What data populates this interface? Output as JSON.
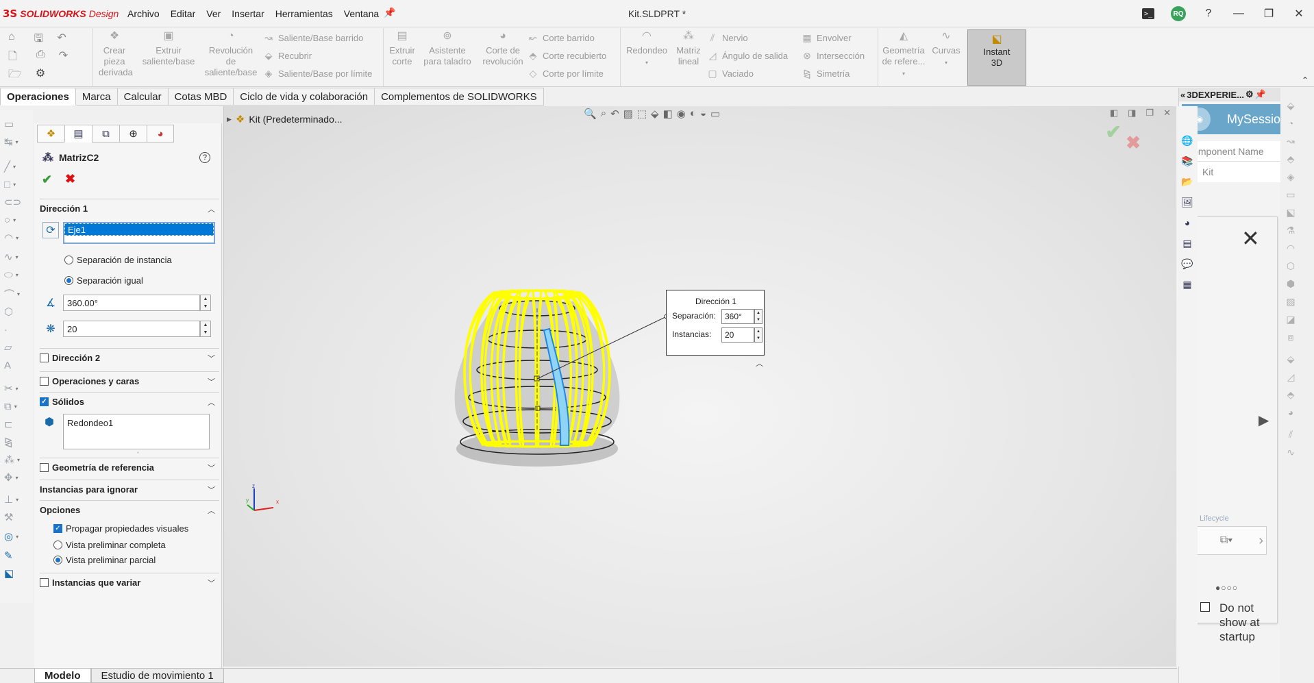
{
  "titlebar": {
    "brand_ds": "3S",
    "brand_name": "SOLIDWORKS",
    "brand_suffix": "Design",
    "menu": [
      "Archivo",
      "Editar",
      "Ver",
      "Insertar",
      "Herramientas",
      "Ventana"
    ],
    "document": "Kit.SLDPRT *",
    "user_initials": "RQ"
  },
  "ribbon": {
    "big_buttons": [
      {
        "label_lines": [
          "Crear",
          "pieza",
          "derivada"
        ],
        "icon": "derived-part-icon"
      },
      {
        "label_lines": [
          "Extruir",
          "saliente/base"
        ],
        "icon": "extrude-boss-icon"
      },
      {
        "label_lines": [
          "Revolución",
          "de",
          "saliente/base"
        ],
        "icon": "revolve-boss-icon"
      },
      {
        "label_lines": [
          "Extruir",
          "corte"
        ],
        "icon": "extrude-cut-icon"
      },
      {
        "label_lines": [
          "Asistente",
          "para taladro"
        ],
        "icon": "hole-wizard-icon"
      },
      {
        "label_lines": [
          "Corte de",
          "revolución"
        ],
        "icon": "revolve-cut-icon"
      },
      {
        "label_lines": [
          "Redondeo"
        ],
        "icon": "fillet-icon"
      },
      {
        "label_lines": [
          "Matriz",
          "lineal"
        ],
        "icon": "linear-pattern-icon"
      },
      {
        "label_lines": [
          "Geometría",
          "de refere..."
        ],
        "icon": "reference-geometry-icon"
      },
      {
        "label_lines": [
          "Curvas"
        ],
        "icon": "curves-icon"
      }
    ],
    "small_col1": [
      "Saliente/Base barrido",
      "Recubrir",
      "Saliente/Base por límite"
    ],
    "small_col2": [
      "Corte barrido",
      "Corte recubierto",
      "Corte por límite"
    ],
    "small_col3": [
      "Nervio",
      "Ángulo de salida",
      "Vaciado"
    ],
    "small_col4": [
      "Envolver",
      "Intersección",
      "Simetría"
    ],
    "instant3d": [
      "Instant",
      "3D"
    ]
  },
  "tabs": [
    "Operaciones",
    "Marca",
    "Calcular",
    "Cotas MBD",
    "Ciclo de vida y colaboración",
    "Complementos de SOLIDWORKS"
  ],
  "property_manager": {
    "feature_name": "MatrizC2",
    "direction1": {
      "title": "Dirección 1",
      "axis": "Eje1",
      "spacing_instance": "Separación de instancia",
      "spacing_equal": "Separación igual",
      "angle": "360.00°",
      "count": "20"
    },
    "direction2": "Dirección 2",
    "features_faces": "Operaciones y caras",
    "bodies": {
      "title": "Sólidos",
      "item": "Redondeo1"
    },
    "ref_geometry": "Geometría de referencia",
    "skip_instances": "Instancias para ignorar",
    "options": {
      "title": "Opciones",
      "propagate": "Propagar propiedades visuales",
      "full_preview": "Vista preliminar completa",
      "partial_preview": "Vista preliminar parcial"
    },
    "vary_instances": "Instancias que variar"
  },
  "viewport": {
    "tree_root": "Kit (Predeterminado...",
    "callout": {
      "title": "Dirección 1",
      "spacing_label": "Separación:",
      "spacing_value": "360°",
      "instances_label": "Instancias:",
      "instances_value": "20"
    },
    "triad": {
      "x": "x",
      "y": "y",
      "z": "z"
    },
    "model_color": "#ffff00"
  },
  "experience_panel": {
    "title": "3DEXPERIE...",
    "session": "MySessio",
    "component_header": "Component Name",
    "component": "Kit",
    "dont_show": "Do not show at startup",
    "lifecycle": "Lifecycle"
  },
  "bottom_tabs": [
    "Modelo",
    "Estudio de movimiento 1"
  ],
  "colors": {
    "accent": "#1a73c9",
    "brand": "#d6141a",
    "selection": "#0078d7"
  }
}
